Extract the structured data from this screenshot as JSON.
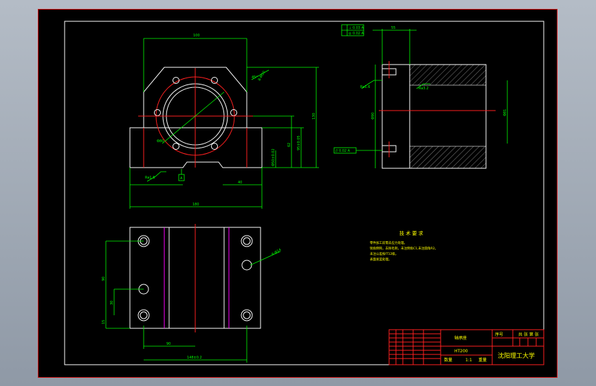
{
  "drawing": {
    "dimensions": {
      "front_top_width": "100",
      "front_bottom_width": "180",
      "front_total_height": "130",
      "front_center_height": "85",
      "front_shoulder_height": "62",
      "front_tol_height": "95±0.05",
      "front_base_height": "45",
      "front_slot_width": "40",
      "front_chamfer": "45°",
      "front_bolt_circle": "8-M10",
      "front_hole_dia": "Φ80",
      "front_small": "Φ50±0.02",
      "front_roughness": "Ra1.6",
      "front_datum": "A",
      "side_top_dim": "55",
      "side_roughness_1": "Ra1.6",
      "side_roughness_2": "Ra3.2",
      "side_height": "Φ90",
      "side_bore": "Φ81",
      "side_tol_box_1": "⊥ 0.03 A",
      "side_tol_box_2": "◎ 0.02 A",
      "side_tol_box_3": "// 0.02 A",
      "top_height": "90",
      "top_inner": "30",
      "top_bottom_off": "15",
      "top_width": "90",
      "top_total": "148±0.2",
      "top_hole": "4-Φ14"
    },
    "tech_requirements": {
      "title": "技 术 要 求",
      "lines": [
        "零件加工前需去应力处理。",
        "锐角倒钝，去除毛刺，未注倒角C1,未注圆角R2。",
        "未注公差按IT12级。",
        "表面发蓝处理。"
      ]
    },
    "title_block": {
      "part_name": "轴承座",
      "material": "HT200",
      "scale": "1:1",
      "school": "沈阳理工大学",
      "drawing_no_label": "序号",
      "sheet_info": "共 张 第 张",
      "qty_label": "数量",
      "weight_label": "重量"
    }
  }
}
